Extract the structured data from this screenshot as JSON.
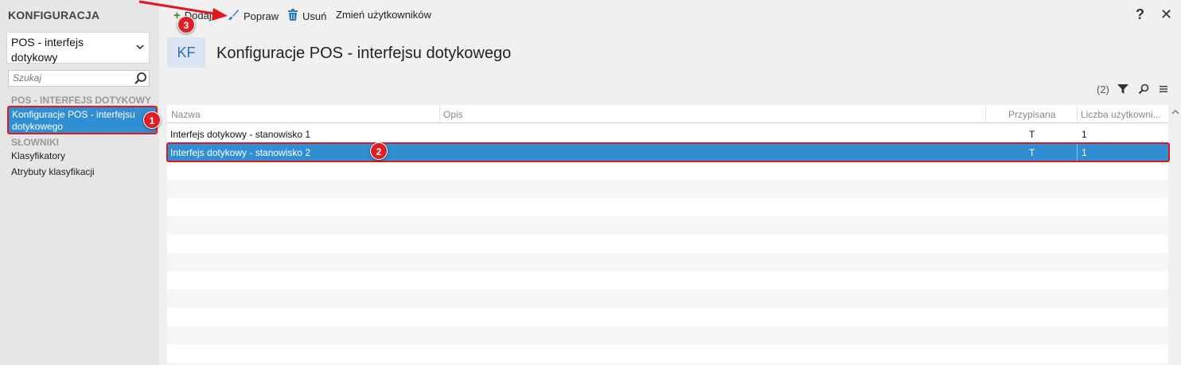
{
  "sidebar": {
    "title": "KONFIGURACJA",
    "module_select": "POS - interfejs dotykowy",
    "search_placeholder": "Szukaj",
    "group1": "POS - INTERFEJS DOTYKOWY",
    "active_item": "Konfiguracje POS - interfejsu dotykowego",
    "group2": "SŁOWNIKI",
    "items": [
      {
        "label": "Klasyfikatory"
      },
      {
        "label": "Atrybuty klasyfikacji"
      }
    ]
  },
  "toolbar": {
    "add_label": "Dodaj",
    "edit_label": "Popraw",
    "delete_label": "Usuń",
    "change_users_label": "Zmień użytkowników",
    "help": "?",
    "close": "✕"
  },
  "page": {
    "badge": "KF",
    "title": "Konfiguracje POS - interfejsu dotykowego",
    "count": "(2)"
  },
  "grid": {
    "columns": [
      "Nazwa",
      "Opis",
      "Przypisana",
      "Liczba użytkowni..."
    ],
    "rows": [
      {
        "nazwa": "Interfejs dotykowy - stanowisko 1",
        "opis": "",
        "przypisana": "T",
        "liczba": "1"
      },
      {
        "nazwa": "Interfejs dotykowy - stanowisko 2",
        "opis": "",
        "przypisana": "T",
        "liczba": "1"
      }
    ]
  },
  "annotations": [
    "1",
    "2",
    "3"
  ],
  "colors": {
    "accent": "#2f8fd2",
    "highlight": "#e0191f",
    "badge_bg": "#d9e6f2"
  }
}
